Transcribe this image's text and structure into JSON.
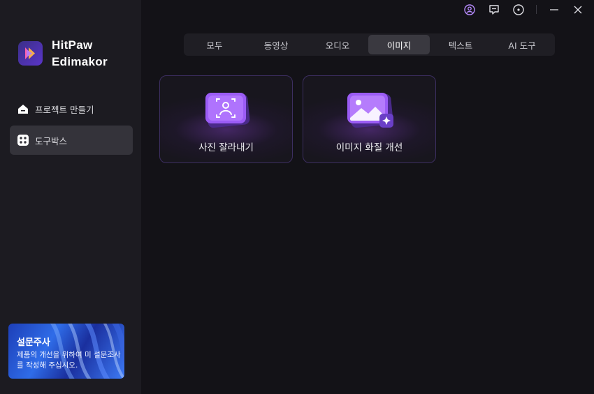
{
  "app": {
    "name_line1": "HitPaw",
    "name_line2": "Edimakor"
  },
  "sidebar": {
    "items": [
      {
        "label": "프로젝트 만들기",
        "icon": "home-icon",
        "active": false
      },
      {
        "label": "도구박스",
        "icon": "toolbox-icon",
        "active": true
      }
    ]
  },
  "survey": {
    "title": "설문주사",
    "description": "제품의 개선을 위하여 미 설문조사를 작성해 주십시오."
  },
  "window_controls": [
    "user-icon",
    "feedback-icon",
    "menu-icon",
    "minimize-icon",
    "close-icon"
  ],
  "tabs": [
    {
      "label": "모두",
      "active": false
    },
    {
      "label": "동영상",
      "active": false
    },
    {
      "label": "오디오",
      "active": false
    },
    {
      "label": "이미지",
      "active": true
    },
    {
      "label": "텍스트",
      "active": false
    },
    {
      "label": "AI 도구",
      "active": false
    }
  ],
  "tools": [
    {
      "label": "사진 잘라내기",
      "icon": "portrait-crop-icon"
    },
    {
      "label": "이미지 화질 개선",
      "icon": "image-enhance-icon"
    }
  ],
  "colors": {
    "background": "#131217",
    "sidebar": "#1c1b21",
    "accent": "#8a4df0",
    "active_tab": "#3a3940"
  }
}
